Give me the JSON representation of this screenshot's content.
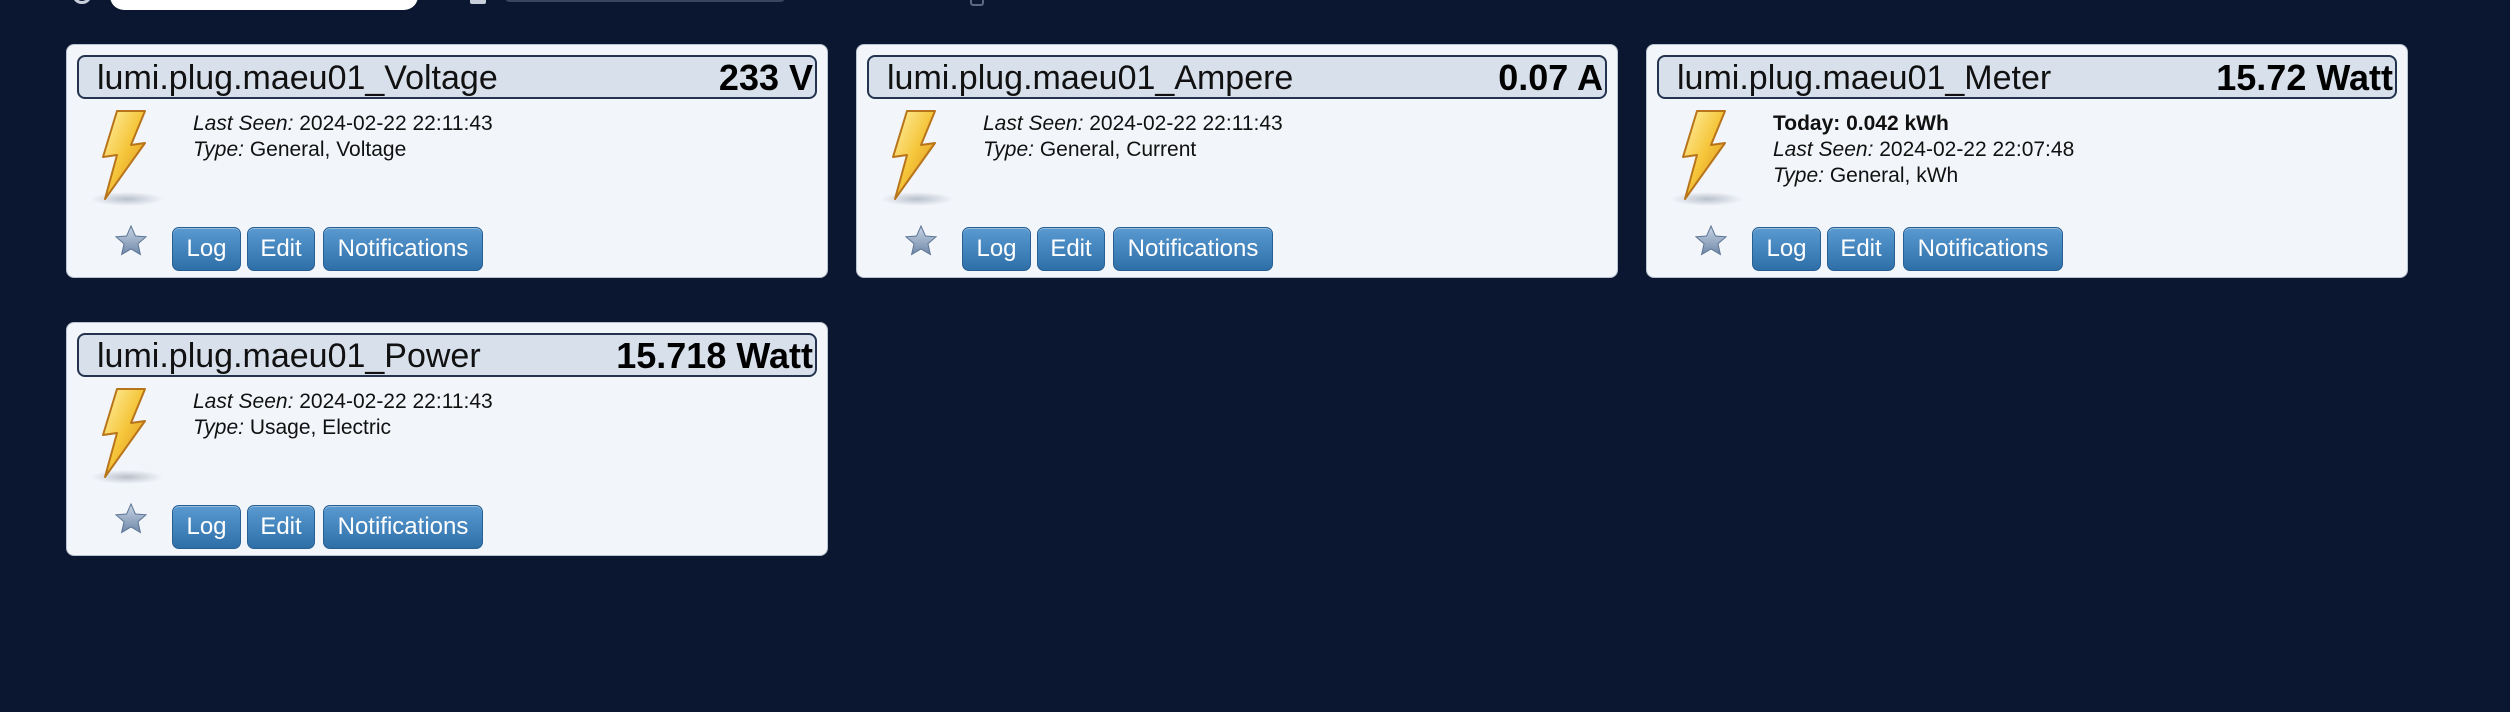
{
  "buttons": {
    "log_label": "Log",
    "edit_label": "Edit",
    "notifications_label": "Notifications"
  },
  "labels": {
    "last_seen": "Last Seen:",
    "type": "Type:"
  },
  "icons": {
    "device": "lightning-bolt-icon",
    "favorite": "star-icon"
  },
  "colors": {
    "background": "#0b1730",
    "card": "#f2f5fa",
    "header": "#d8e0ec",
    "button": "#3f82bf"
  },
  "devices": [
    {
      "name": "lumi.plug.maeu01_Voltage",
      "value": "233 V",
      "last_seen": "2024-02-22 22:11:43",
      "type": "General, Voltage"
    },
    {
      "name": "lumi.plug.maeu01_Ampere",
      "value": "0.07 A",
      "last_seen": "2024-02-22 22:11:43",
      "type": "General, Current"
    },
    {
      "name": "lumi.plug.maeu01_Meter",
      "value": "15.72 Watt",
      "today": "Today: 0.042 kWh",
      "last_seen": "2024-02-22 22:07:48",
      "type": "General, kWh"
    },
    {
      "name": "lumi.plug.maeu01_Power",
      "value": "15.718 Watt",
      "last_seen": "2024-02-22 22:11:43",
      "type": "Usage, Electric"
    }
  ]
}
